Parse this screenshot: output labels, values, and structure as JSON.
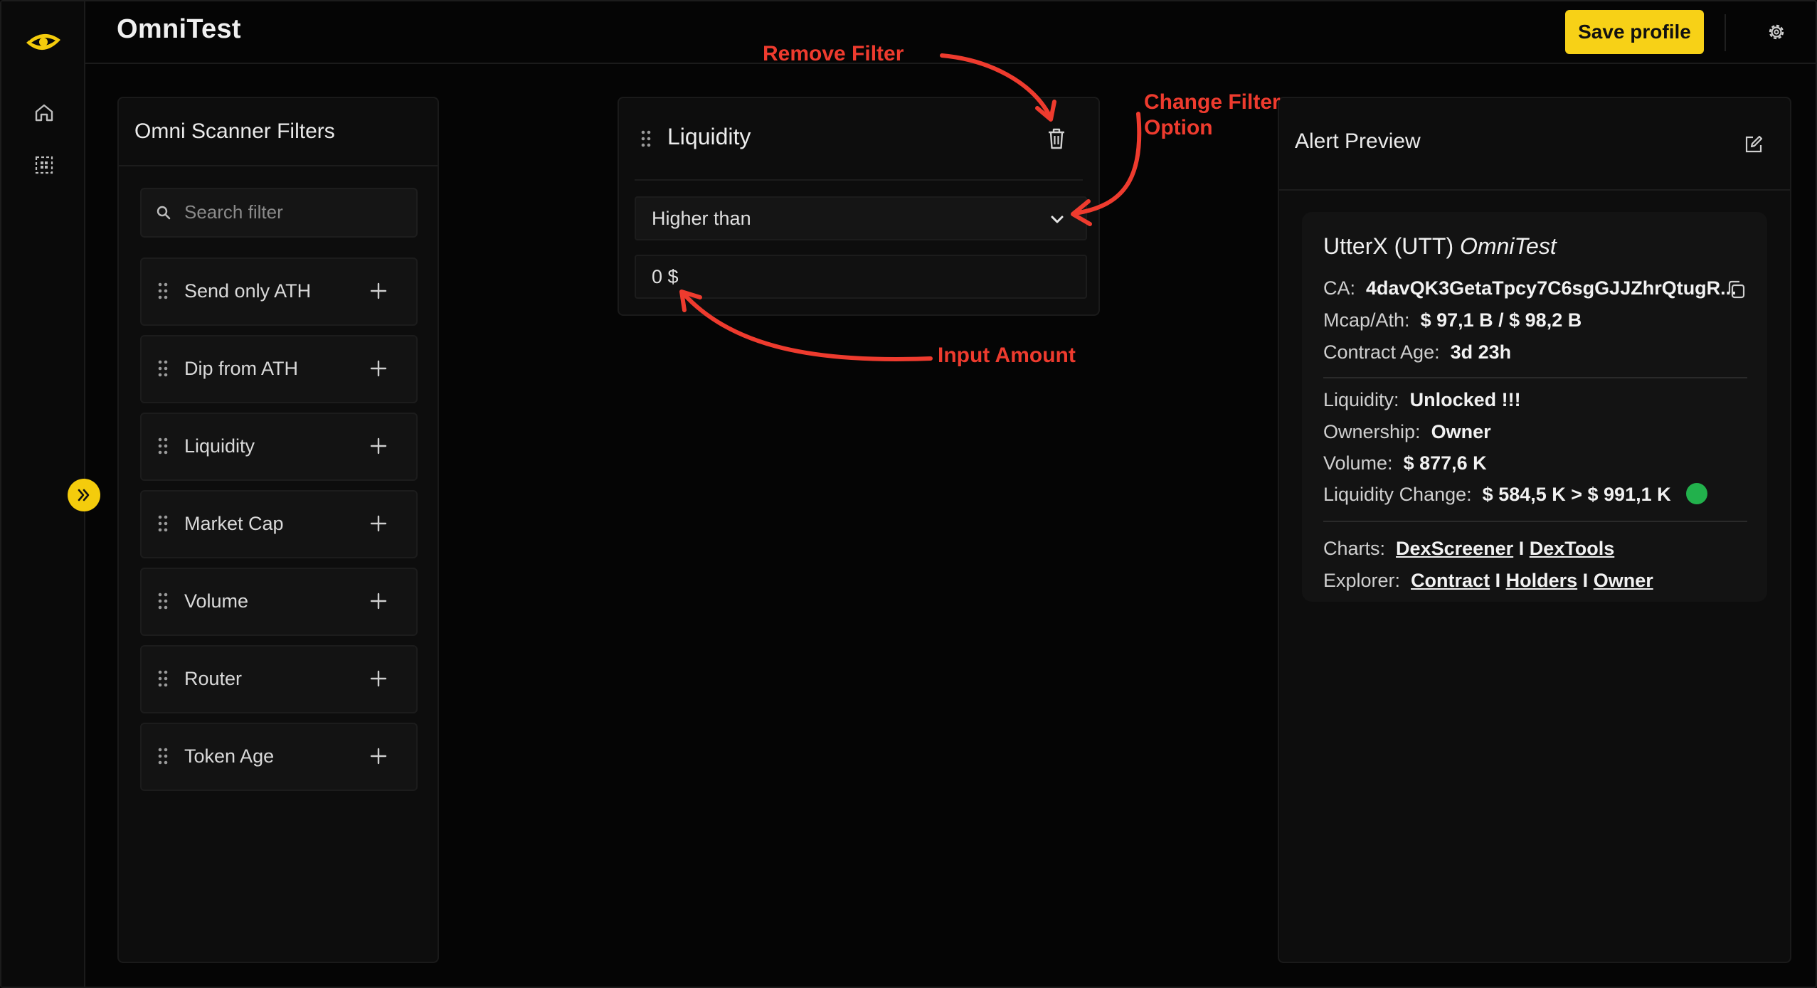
{
  "app": {
    "title": "OmniTest"
  },
  "header": {
    "save_label": "Save profile",
    "settings_icon": "gear-icon"
  },
  "rail": {
    "icons": [
      "eye-logo-icon",
      "home-icon",
      "grid-dashed-icon"
    ],
    "expand_icon": "double-chevron-right-icon"
  },
  "filters": {
    "title": "Omni Scanner Filters",
    "search_placeholder": "Search filter",
    "items": [
      {
        "label": "Send only ATH"
      },
      {
        "label": "Dip from ATH"
      },
      {
        "label": "Liquidity"
      },
      {
        "label": "Market Cap"
      },
      {
        "label": "Volume"
      },
      {
        "label": "Router"
      },
      {
        "label": "Token Age"
      }
    ]
  },
  "active_filter": {
    "title": "Liquidity",
    "option": "Higher than",
    "amount": "0 $"
  },
  "alert_preview": {
    "title": "Alert Preview",
    "token_name": "UtterX (UTT)",
    "token_source": "OmniTest",
    "ca_label": "CA:",
    "ca_value": "4davQK3GetaTpcy7C6sgGJJZhrQtugR...",
    "mcap_label": "Mcap/Ath:",
    "mcap_value": "$ 97,1 B / $ 98,2 B",
    "age_label": "Contract Age:",
    "age_value": "3d 23h",
    "liquidity_label": "Liquidity:",
    "liquidity_value": "Unlocked !!!",
    "ownership_label": "Ownership:",
    "ownership_value": "Owner",
    "volume_label": "Volume:",
    "volume_value": "$ 877,6 K",
    "liq_change_label": "Liquidity Change:",
    "liq_change_value": "$ 584,5 K > $ 991,1 K",
    "charts_label": "Charts:",
    "chart_links": [
      "DexScreener",
      "DexTools"
    ],
    "explorer_label": "Explorer:",
    "explorer_links": [
      "Contract",
      "Holders",
      "Owner"
    ],
    "separator": "I",
    "status_color": "#22b14c"
  },
  "annotations": {
    "remove_filter": "Remove Filter",
    "change_filter_1": "Change Filter",
    "change_filter_2": "Option",
    "input_amount": "Input Amount",
    "color": "#ee3b2e"
  },
  "colors": {
    "accent": "#f7d117",
    "background": "#050505",
    "panel": "#0d0d0d"
  }
}
